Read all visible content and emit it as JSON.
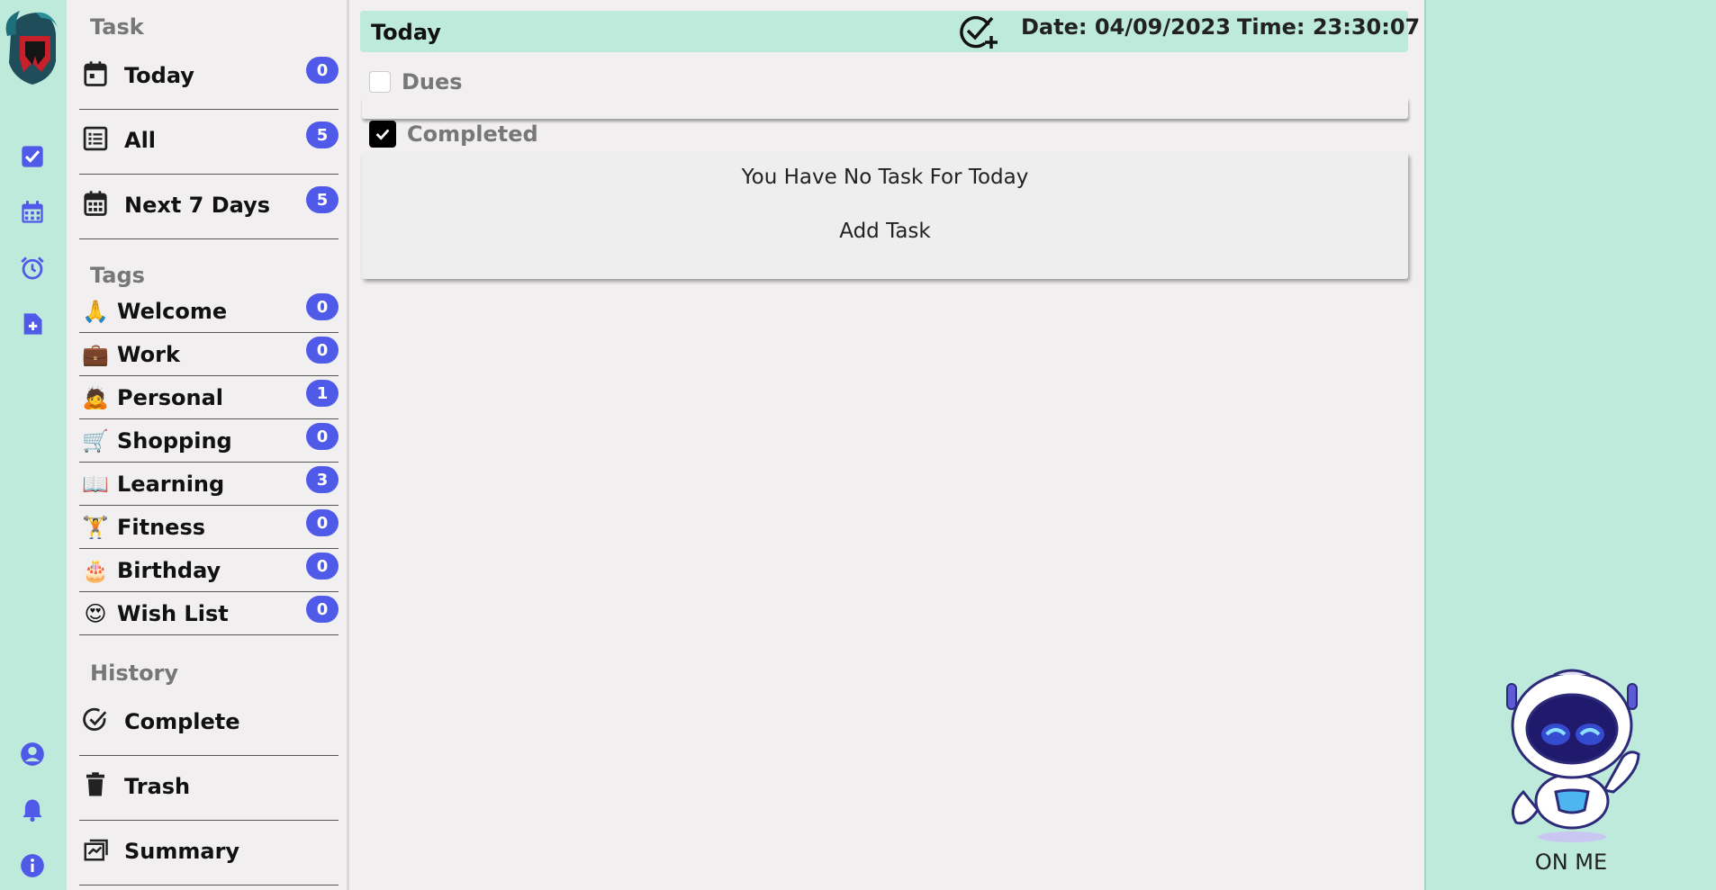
{
  "rail": {
    "logo": "spartan-helmet-logo",
    "top_icons": [
      "check-square-icon",
      "calendar-icon",
      "alarm-clock-icon",
      "file-add-icon"
    ],
    "bottom_icons": [
      "user-circle-icon",
      "bell-icon",
      "info-icon"
    ],
    "accent_color": "#4f5ae8"
  },
  "sidebar": {
    "task_heading": "Task",
    "task_items": [
      {
        "label": "Today",
        "count": "0",
        "icon": "calendar-day-icon"
      },
      {
        "label": "All",
        "count": "5",
        "icon": "list-icon"
      },
      {
        "label": "Next 7 Days",
        "count": "5",
        "icon": "calendar-week-icon"
      }
    ],
    "tags_heading": "Tags",
    "tag_items": [
      {
        "label": "Welcome",
        "count": "0",
        "emoji": "🙏"
      },
      {
        "label": "Work",
        "count": "0",
        "emoji": "💼"
      },
      {
        "label": "Personal",
        "count": "1",
        "emoji": "🙇"
      },
      {
        "label": "Shopping",
        "count": "0",
        "emoji": "🛒"
      },
      {
        "label": "Learning",
        "count": "3",
        "emoji": "📖"
      },
      {
        "label": "Fitness",
        "count": "0",
        "emoji": "🏋"
      },
      {
        "label": "Birthday",
        "count": "0",
        "emoji": "🎂"
      },
      {
        "label": "Wish List",
        "count": "0",
        "emoji": "😍"
      }
    ],
    "history_heading": "History",
    "history_items": [
      {
        "label": "Complete",
        "icon": "check-circle-icon"
      },
      {
        "label": "Trash",
        "icon": "trash-icon"
      },
      {
        "label": "Summary",
        "icon": "summary-icon"
      }
    ]
  },
  "main": {
    "title": "Today",
    "date": "Date: 04/09/2023",
    "time": "Time: 23:30:07",
    "dues_label": "Dues",
    "completed_label": "Completed",
    "empty_message": "You Have No Task For Today",
    "add_task_label": "Add Task"
  },
  "right_panel": {
    "caption": "ON ME"
  },
  "colors": {
    "mint": "#bdeadb",
    "panel": "#f1eff0",
    "badge": "#4f5ae8"
  }
}
